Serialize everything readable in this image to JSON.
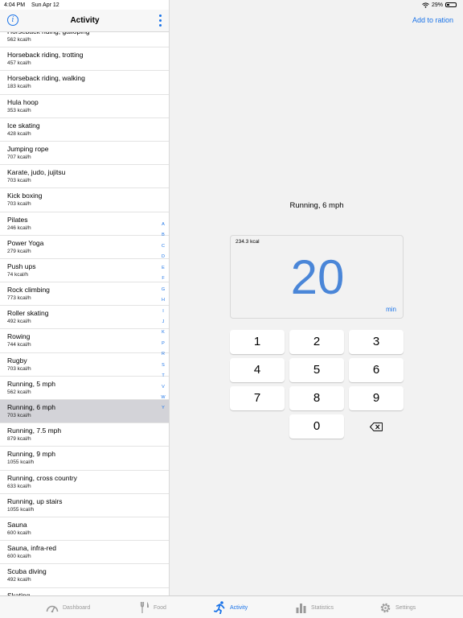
{
  "status_bar": {
    "time": "4:04 PM",
    "date": "Sun Apr 12",
    "battery": "29%"
  },
  "left_panel": {
    "title": "Activity",
    "items": [
      {
        "name": "Horseback riding, galloping",
        "kcal": "562 kcal/h"
      },
      {
        "name": "Horseback riding, trotting",
        "kcal": "457 kcal/h"
      },
      {
        "name": "Horseback riding, walking",
        "kcal": "183 kcal/h"
      },
      {
        "name": "Hula hoop",
        "kcal": "353 kcal/h"
      },
      {
        "name": "Ice skating",
        "kcal": "428 kcal/h"
      },
      {
        "name": "Jumping rope",
        "kcal": "707 kcal/h"
      },
      {
        "name": "Karate, judo, jujitsu",
        "kcal": "703 kcal/h"
      },
      {
        "name": "Kick boxing",
        "kcal": "703 kcal/h"
      },
      {
        "name": "Pilates",
        "kcal": "246 kcal/h"
      },
      {
        "name": "Power Yoga",
        "kcal": "279 kcal/h"
      },
      {
        "name": "Push ups",
        "kcal": "74 kcal/h"
      },
      {
        "name": "Rock climbing",
        "kcal": "773 kcal/h"
      },
      {
        "name": "Roller skating",
        "kcal": "492 kcal/h"
      },
      {
        "name": "Rowing",
        "kcal": "744 kcal/h"
      },
      {
        "name": "Rugby",
        "kcal": "703 kcal/h"
      },
      {
        "name": "Running, 5 mph",
        "kcal": "562 kcal/h"
      },
      {
        "name": "Running, 6 mph",
        "kcal": "703 kcal/h"
      },
      {
        "name": "Running, 7.5 mph",
        "kcal": "879 kcal/h"
      },
      {
        "name": "Running, 9 mph",
        "kcal": "1055 kcal/h"
      },
      {
        "name": "Running, cross country",
        "kcal": "633 kcal/h"
      },
      {
        "name": "Running, up stairs",
        "kcal": "1055 kcal/h"
      },
      {
        "name": "Sauna",
        "kcal": "600 kcal/h"
      },
      {
        "name": "Sauna, infra-red",
        "kcal": "600 kcal/h"
      },
      {
        "name": "Scuba diving",
        "kcal": "492 kcal/h"
      },
      {
        "name": "Skating",
        "kcal": ""
      }
    ],
    "selected_item": "Running, 6 mph",
    "index_letters": [
      "A",
      "B",
      "C",
      "D",
      "E",
      "F",
      "G",
      "H",
      "I",
      "J",
      "K",
      "P",
      "R",
      "S",
      "T",
      "V",
      "W",
      "Y"
    ]
  },
  "right_panel": {
    "add_button": "Add to ration",
    "activity_name": "Running, 6 mph",
    "kcal_readout": "234.3 kcal",
    "minutes_value": "20",
    "unit": "min",
    "keys": [
      "1",
      "2",
      "3",
      "4",
      "5",
      "6",
      "7",
      "8",
      "9",
      "0"
    ]
  },
  "tab_bar": {
    "tabs": [
      {
        "label": "Dashboard",
        "icon": "gauge-icon"
      },
      {
        "label": "Food",
        "icon": "fork-knife-icon"
      },
      {
        "label": "Activity",
        "icon": "runner-icon"
      },
      {
        "label": "Statistics",
        "icon": "bar-chart-icon"
      },
      {
        "label": "Settings",
        "icon": "gear-icon"
      }
    ],
    "active": "Activity"
  },
  "colors": {
    "accent": "#1a73e8",
    "selected_row": "#d3d3d8",
    "display_number": "#4a86d8"
  }
}
